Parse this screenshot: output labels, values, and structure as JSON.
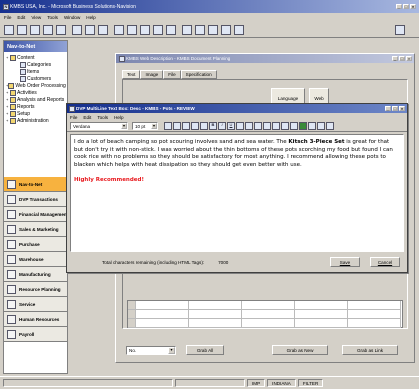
{
  "app": {
    "title": "KMBS USA, Inc. - Microsoft Business Solutions-Navision",
    "menu": [
      "File",
      "Edit",
      "View",
      "Tools",
      "Window",
      "Help"
    ],
    "nav_title": "Nav-to-Net",
    "status": [
      "IMP",
      "INDIANA",
      "FILTER"
    ]
  },
  "tree": [
    {
      "label": "Content",
      "depth": 0
    },
    {
      "label": "Categories",
      "depth": 1
    },
    {
      "label": "Items",
      "depth": 1
    },
    {
      "label": "Customers",
      "depth": 1
    },
    {
      "label": "Web Order Processing",
      "depth": 0
    },
    {
      "label": "Activities",
      "depth": 0
    },
    {
      "label": "Analysis and Reports",
      "depth": 0
    },
    {
      "label": "Reports",
      "depth": 0
    },
    {
      "label": "Setup",
      "depth": 0
    },
    {
      "label": "Administration",
      "depth": 0
    }
  ],
  "nav_buttons": [
    {
      "label": "Nav-to-Net",
      "active": true
    },
    {
      "label": "DVP Transactions",
      "active": false
    },
    {
      "label": "Financial Management",
      "active": false
    },
    {
      "label": "Sales & Marketing",
      "active": false
    },
    {
      "label": "Purchase",
      "active": false
    },
    {
      "label": "Warehouse",
      "active": false
    },
    {
      "label": "Manufacturing",
      "active": false
    },
    {
      "label": "Resource Planning",
      "active": false
    },
    {
      "label": "Service",
      "active": false
    },
    {
      "label": "Human Resources",
      "active": false
    },
    {
      "label": "Payroll",
      "active": false
    }
  ],
  "item_window": {
    "title": "KMBS Web Description - KMBS Document Planning",
    "tabs": [
      "Text",
      "Image",
      "File",
      "Specification"
    ],
    "col_language": "Language",
    "col_web": "Web",
    "dropdown_value": "No.",
    "grab_all": "Grab All",
    "grab_as_new": "Grab as New",
    "grab_as_link": "Grab as Link"
  },
  "editor": {
    "title": "DVP MultiLine Text Box: Desc - KMBS - Pots - REVIEW",
    "menu": [
      "File",
      "Edit",
      "Tools",
      "Help"
    ],
    "font": "Verdana",
    "size": "10 pt",
    "body_before": "I do a lot of beach camping so pot scouring involves sand and sea water. The ",
    "body_bold": "Kitsch 3-Piece Set",
    "body_after": " is great for that but don't try it with non-stick. I was worried about the thin bottoms of these pots scorching my food but found I can cook rice with no problems so they should be satisfactory for most anything. I recommend allowing these pots to blacken which helps with heat dissipation so they should get even better with use.",
    "highlight": "Highly Recommended!",
    "chars_label": "Total characters remaining (including HTML Tags):",
    "chars_value": "7000",
    "save": "Save",
    "cancel": "Cancel"
  }
}
